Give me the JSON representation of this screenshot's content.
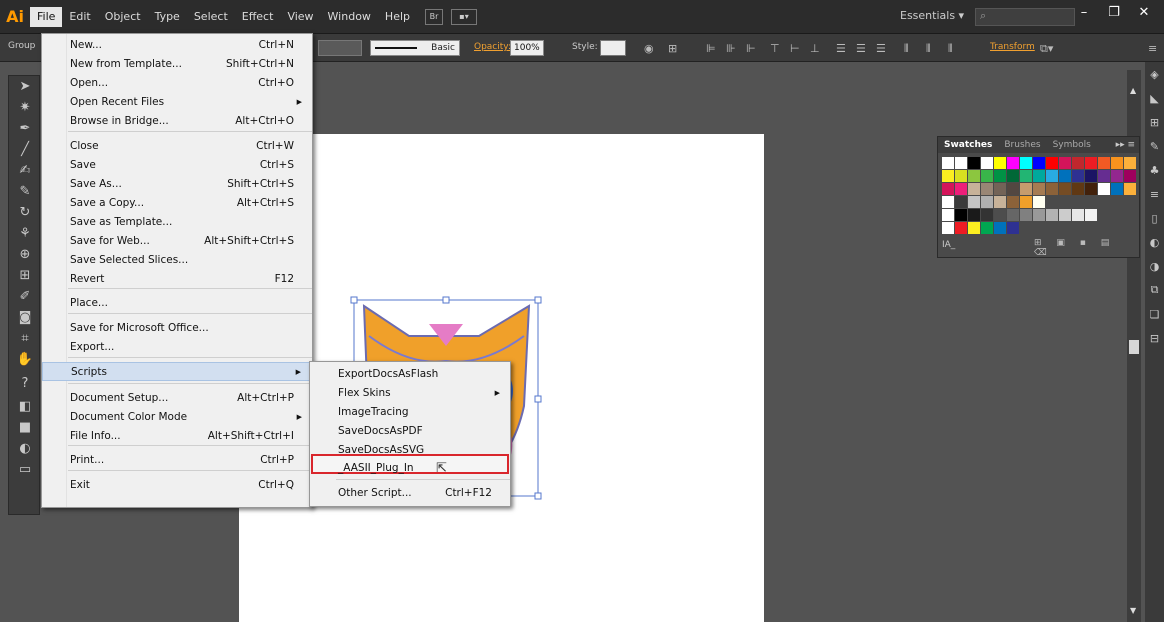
{
  "app": {
    "logo": "Ai"
  },
  "menubar": {
    "items": [
      "File",
      "Edit",
      "Object",
      "Type",
      "Select",
      "Effect",
      "View",
      "Window",
      "Help"
    ],
    "bridge_button": "Br",
    "arrange_button": "▪▾",
    "workspace": "Essentials",
    "window_controls": [
      "–",
      "❐",
      "✕"
    ]
  },
  "controlbar": {
    "group_label": "Group",
    "stroke_profile": "Basic",
    "opacity_label": "Opacity:",
    "opacity_value": "100%",
    "style_label": "Style:",
    "transform_link": "Transform"
  },
  "file_menu": {
    "items": [
      {
        "label": "New...",
        "shortcut": "Ctrl+N"
      },
      {
        "label": "New from Template...",
        "shortcut": "Shift+Ctrl+N"
      },
      {
        "label": "Open...",
        "shortcut": "Ctrl+O"
      },
      {
        "label": "Open Recent Files",
        "shortcut": "",
        "submenu": true
      },
      {
        "label": "Browse in Bridge...",
        "shortcut": "Alt+Ctrl+O"
      },
      {
        "label": "Close",
        "shortcut": "Ctrl+W"
      },
      {
        "label": "Save",
        "shortcut": "Ctrl+S"
      },
      {
        "label": "Save As...",
        "shortcut": "Shift+Ctrl+S"
      },
      {
        "label": "Save a Copy...",
        "shortcut": "Alt+Ctrl+S"
      },
      {
        "label": "Save as Template...",
        "shortcut": ""
      },
      {
        "label": "Save for Web...",
        "shortcut": "Alt+Shift+Ctrl+S"
      },
      {
        "label": "Save Selected Slices...",
        "shortcut": ""
      },
      {
        "label": "Revert",
        "shortcut": "F12"
      },
      {
        "label": "Place...",
        "shortcut": ""
      },
      {
        "label": "Save for Microsoft Office...",
        "shortcut": ""
      },
      {
        "label": "Export...",
        "shortcut": ""
      },
      {
        "label": "Scripts",
        "shortcut": "",
        "submenu": true
      },
      {
        "label": "Document Setup...",
        "shortcut": "Alt+Ctrl+P"
      },
      {
        "label": "Document Color Mode",
        "shortcut": "",
        "submenu": true
      },
      {
        "label": "File Info...",
        "shortcut": "Alt+Shift+Ctrl+I"
      },
      {
        "label": "Print...",
        "shortcut": "Ctrl+P"
      },
      {
        "label": "Exit",
        "shortcut": "Ctrl+Q"
      }
    ]
  },
  "scripts_menu": {
    "items": [
      {
        "label": "ExportDocsAsFlash",
        "shortcut": ""
      },
      {
        "label": "Flex Skins",
        "shortcut": "",
        "submenu": true
      },
      {
        "label": "ImageTracing",
        "shortcut": ""
      },
      {
        "label": "SaveDocsAsPDF",
        "shortcut": ""
      },
      {
        "label": "SaveDocsAsSVG",
        "shortcut": ""
      },
      {
        "label": "_AASII_Plug_In",
        "shortcut": "",
        "highlighted": true
      },
      {
        "label": "Other Script...",
        "shortcut": "Ctrl+F12"
      }
    ]
  },
  "swatches_panel": {
    "tabs": [
      "Swatches",
      "Brushes",
      "Symbols"
    ],
    "active_tab": "Swatches",
    "footer_label": "IA_"
  },
  "colors": {
    "accent": "#ff9a00",
    "highlight_box": "#d9262c",
    "menu_hover": "#d2dff0"
  }
}
